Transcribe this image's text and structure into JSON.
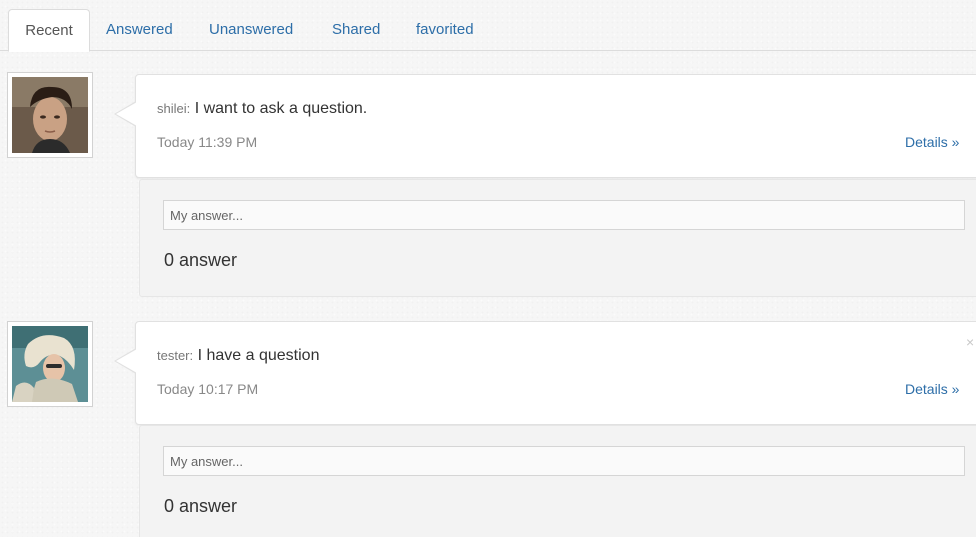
{
  "tabs": [
    {
      "label": "Recent",
      "active": true
    },
    {
      "label": "Answered",
      "active": false
    },
    {
      "label": "Unanswered",
      "active": false
    },
    {
      "label": "Shared",
      "active": false
    },
    {
      "label": "favorited",
      "active": false
    }
  ],
  "colors": {
    "link": "#2d6ea8",
    "background": "#f6f6f6",
    "card": "#ffffff",
    "answer_panel": "#f3f3f3"
  },
  "questions": [
    {
      "avatar_icon": "user-avatar-dark-hair",
      "author": "shilei",
      "separator": ":",
      "text": "I want to ask a question.",
      "time": "Today 11:39 PM",
      "details_label": "Details »",
      "has_close": false,
      "answer_placeholder": "My answer...",
      "answer_count": "0 answer"
    },
    {
      "avatar_icon": "user-avatar-blonde",
      "author": "tester",
      "separator": ":",
      "text": "I have a question",
      "time": "Today 10:17 PM",
      "details_label": "Details »",
      "has_close": true,
      "close_glyph": "×",
      "answer_placeholder": "My answer...",
      "answer_count": "0 answer"
    }
  ]
}
